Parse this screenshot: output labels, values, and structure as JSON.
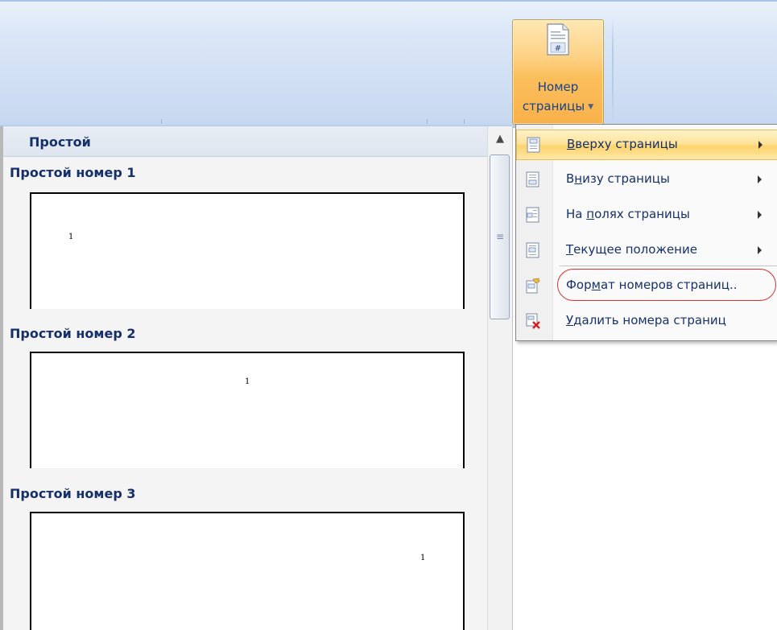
{
  "ribbon": {
    "page_number_button": {
      "label_line1": "Номер",
      "label_line2": "страницы",
      "icon": "page-number-icon",
      "icon_glyph": "#"
    }
  },
  "gallery": {
    "category": "Простой",
    "items": [
      {
        "title": "Простой номер 1",
        "number": "1",
        "alignment": "left"
      },
      {
        "title": "Простой номер 2",
        "number": "1",
        "alignment": "center"
      },
      {
        "title": "Простой номер 3",
        "number": "1",
        "alignment": "right"
      }
    ],
    "scroll_up_glyph": "▲",
    "scroll_grip_glyph": "≡"
  },
  "menu": {
    "items": [
      {
        "before": "",
        "accel": "В",
        "after": "верху страницы",
        "icon": "page-top-icon",
        "submenu": true,
        "highlighted": true
      },
      {
        "before": "В",
        "accel": "н",
        "after": "изу страницы",
        "icon": "page-bottom-icon",
        "submenu": true,
        "highlighted": false
      },
      {
        "before": "На ",
        "accel": "п",
        "after": "олях страницы",
        "icon": "page-margins-icon",
        "submenu": true,
        "highlighted": false
      },
      {
        "before": "",
        "accel": "Т",
        "after": "екущее положение",
        "icon": "current-position-icon",
        "submenu": true,
        "highlighted": false
      },
      {
        "before": "Фор",
        "accel": "м",
        "after": "ат номеров страниц..",
        "icon": "format-page-numbers-icon",
        "submenu": false,
        "highlighted": false
      },
      {
        "before": "",
        "accel": "У",
        "after": "далить номера страниц",
        "icon": "remove-page-numbers-icon",
        "submenu": false,
        "highlighted": false
      }
    ]
  },
  "colors": {
    "menu_text": "#15316b",
    "highlight": "#fdd46f",
    "annotation_oval": "#d93030"
  }
}
